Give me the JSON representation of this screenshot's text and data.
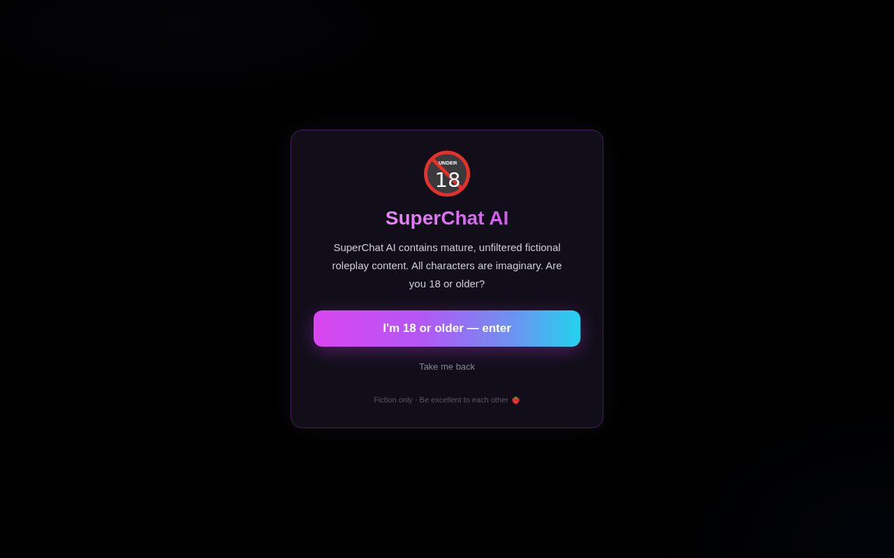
{
  "dialog": {
    "badge": {
      "caption": "UNDER",
      "number": "18"
    },
    "title": "SuperChat AI",
    "message": "SuperChat AI contains mature, unfiltered fictional roleplay content. All characters are imaginary. Are you 18 or older?",
    "confirm_button": "I'm 18 or older — enter",
    "back_link": "Take me back",
    "footer_note": "Fiction only · Be excellent to each other"
  }
}
